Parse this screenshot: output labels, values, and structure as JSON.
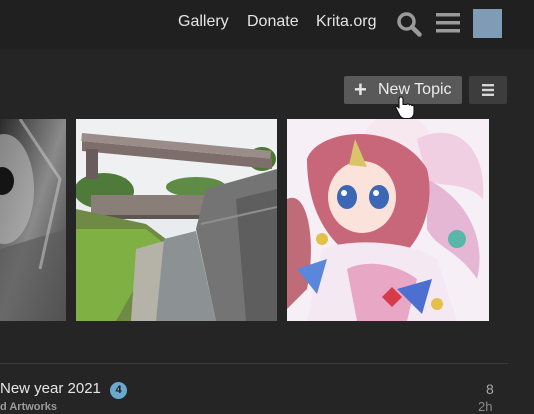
{
  "header": {
    "nav": [
      "Gallery",
      "Donate",
      "Krita.org"
    ],
    "icons": [
      "search-icon",
      "hamburger-menu-icon"
    ],
    "avatar_color": "#7f9bb5"
  },
  "toolbar": {
    "new_topic_label": "New Topic",
    "plus_glyph": "+",
    "icons": [
      "plus-icon",
      "list-icon",
      "pointer-hand-cursor"
    ]
  },
  "gallery": {
    "thumbnails": [
      "monochrome-sketch",
      "urban-canal-bridge-painting",
      "anime-unicorn-girl-illustration"
    ]
  },
  "topic": {
    "title": "New year 2021",
    "badge": "4",
    "category": "d Artworks",
    "replies": "8",
    "activity": "2h"
  },
  "colors": {
    "background": "#252525",
    "header": "#202020",
    "button": "#595959",
    "badge": "#6aa8cc"
  }
}
